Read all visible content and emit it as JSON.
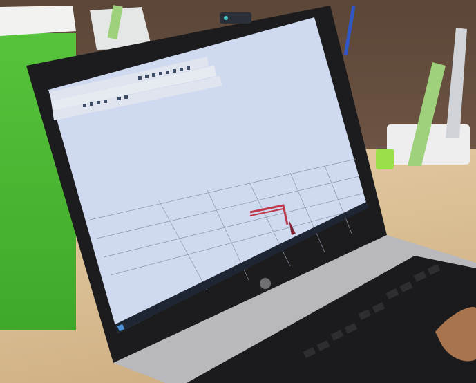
{
  "scene": {
    "description_free": true,
    "colors": {
      "wall": "#5b4637",
      "desk": "#dcc39a",
      "green_panel": "#4cb836",
      "laptop_bezel": "#1c1c1e",
      "laptop_body": "#b9b9bd",
      "screen": "#cfd9ef",
      "keyboard": "#1b1b1d",
      "grid_lines": "#8e96a8",
      "red_object": "#c0394a"
    },
    "icons": [
      "hp-logo-icon",
      "windows-start-icon",
      "camera-icon"
    ]
  }
}
